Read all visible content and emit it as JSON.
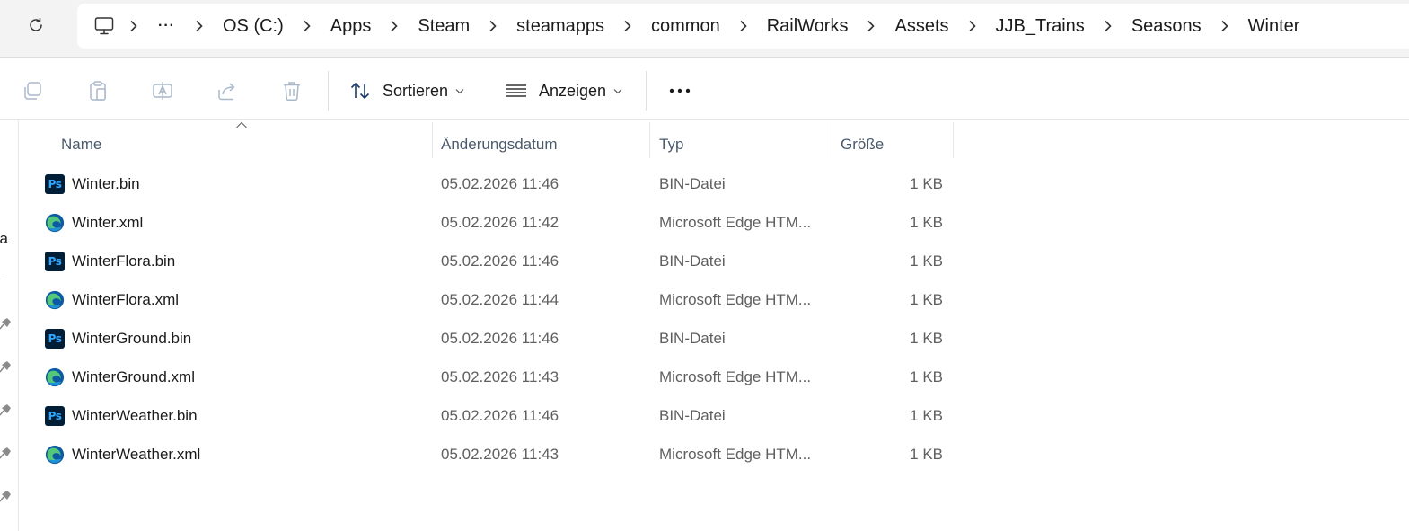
{
  "breadcrumb": {
    "more": "···",
    "items": [
      "OS (C:)",
      "Apps",
      "Steam",
      "steamapps",
      "common",
      "RailWorks",
      "Assets",
      "JJB_Trains",
      "Seasons",
      "Winter"
    ]
  },
  "commandbar": {
    "sort_label": "Sortieren",
    "view_label": "Anzeigen",
    "more": "•••"
  },
  "navpane": {
    "partial_text": "na"
  },
  "columns": {
    "name": "Name",
    "date": "Änderungsdatum",
    "type": "Typ",
    "size": "Größe"
  },
  "icons": {
    "ps_label": "Ps",
    "bin": "photoshop-file-icon",
    "xml": "edge-file-icon"
  },
  "colors": {
    "ps_bg": "#001e36",
    "ps_fg": "#31a8ff",
    "edge_blue": "#0c59a4",
    "edge_green": "#54c77a"
  },
  "files": [
    {
      "name": "Winter.bin",
      "date": "05.02.2026 11:46",
      "type": "BIN-Datei",
      "size": "1 KB",
      "kind": "bin"
    },
    {
      "name": "Winter.xml",
      "date": "05.02.2026 11:42",
      "type": "Microsoft Edge HTM...",
      "size": "1 KB",
      "kind": "xml"
    },
    {
      "name": "WinterFlora.bin",
      "date": "05.02.2026 11:46",
      "type": "BIN-Datei",
      "size": "1 KB",
      "kind": "bin"
    },
    {
      "name": "WinterFlora.xml",
      "date": "05.02.2026 11:44",
      "type": "Microsoft Edge HTM...",
      "size": "1 KB",
      "kind": "xml"
    },
    {
      "name": "WinterGround.bin",
      "date": "05.02.2026 11:46",
      "type": "BIN-Datei",
      "size": "1 KB",
      "kind": "bin"
    },
    {
      "name": "WinterGround.xml",
      "date": "05.02.2026 11:43",
      "type": "Microsoft Edge HTM...",
      "size": "1 KB",
      "kind": "xml"
    },
    {
      "name": "WinterWeather.bin",
      "date": "05.02.2026 11:46",
      "type": "BIN-Datei",
      "size": "1 KB",
      "kind": "bin"
    },
    {
      "name": "WinterWeather.xml",
      "date": "05.02.2026 11:43",
      "type": "Microsoft Edge HTM...",
      "size": "1 KB",
      "kind": "xml"
    }
  ]
}
